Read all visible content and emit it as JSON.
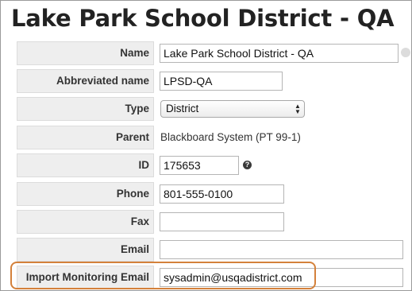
{
  "page": {
    "title": "Lake Park School District - QA"
  },
  "form": {
    "name": {
      "label": "Name",
      "value": "Lake Park School District - QA"
    },
    "abbreviated_name": {
      "label": "Abbreviated name",
      "value": "LPSD-QA"
    },
    "type": {
      "label": "Type",
      "selected": "District"
    },
    "parent": {
      "label": "Parent",
      "value": "Blackboard System (PT 99-1)"
    },
    "id": {
      "label": "ID",
      "value": "175653",
      "help_icon": "question-circle-icon"
    },
    "phone": {
      "label": "Phone",
      "value": "801-555-0100"
    },
    "fax": {
      "label": "Fax",
      "value": ""
    },
    "email": {
      "label": "Email",
      "value": ""
    },
    "import_monitoring_email": {
      "label": "Import Monitoring Email",
      "value": "sysadmin@usqadistrict.com"
    }
  },
  "colors": {
    "highlight": "#d4813b",
    "label_bg": "#eeeeee"
  }
}
